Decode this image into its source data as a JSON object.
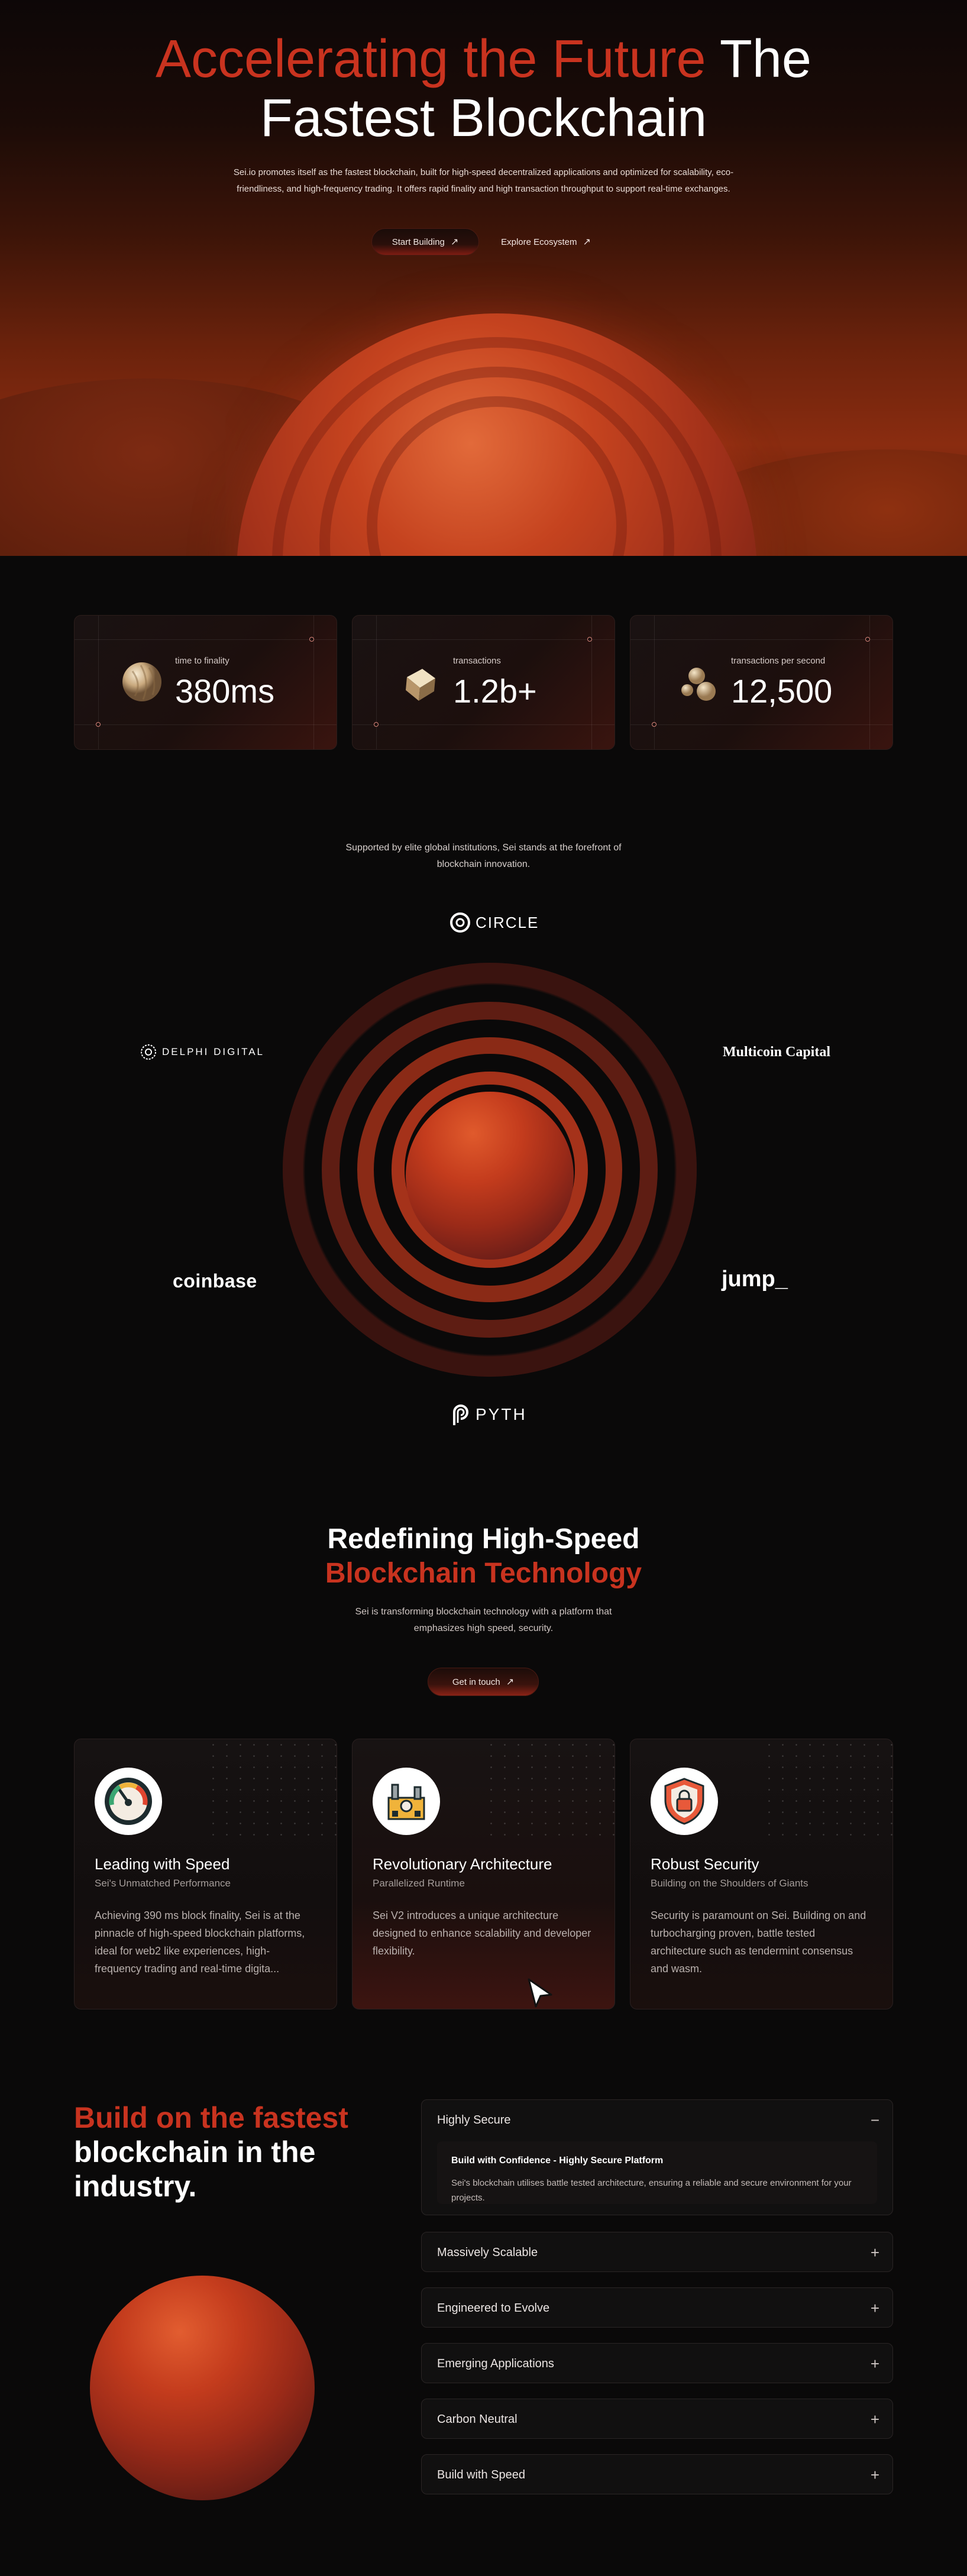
{
  "hero": {
    "title_accent": "Accelerating the Future",
    "title_rest_1": "The",
    "title_rest_2": "Fastest Blockchain",
    "description": "Sei.io promotes itself as the fastest blockchain, built for high-speed decentralized applications and optimized for scalability, eco-friendliness, and high-frequency trading. It offers rapid finality and high transaction throughput to support real-time exchanges.",
    "primary_button": "Start Building",
    "secondary_button": "Explore Ecosystem",
    "arrow": "↗"
  },
  "stats": [
    {
      "label": "time to finality",
      "value": "380ms",
      "icon": "sphere-icon"
    },
    {
      "label": "transactions",
      "value": "1.2b+",
      "icon": "cube-icon"
    },
    {
      "label": "transactions per second",
      "value": "12,500",
      "icon": "spheres-icon"
    }
  ],
  "support": {
    "text": "Supported by elite global institutions, Sei stands at the forefront of blockchain innovation.",
    "logos": {
      "circle": "CIRCLE",
      "delphi": "DELPHI DIGITAL",
      "multicoin": "Multicoin Capital",
      "coinbase": "coinbase",
      "jump": "jump_",
      "pyth": "PYTH"
    }
  },
  "redefining": {
    "title_line1": "Redefining High-Speed",
    "title_line2": "Blockchain Technology",
    "description": "Sei is transforming blockchain technology with a platform that emphasizes high speed, security.",
    "button": "Get in touch",
    "arrow": "↗"
  },
  "features": [
    {
      "title": "Leading with Speed",
      "subtitle": "Sei's Unmatched Performance",
      "body": "Achieving 390 ms block finality, Sei is at the pinnacle of high-speed blockchain platforms, ideal for web2 like experiences, high-frequency trading and real-time digita...",
      "icon": "speedometer-icon"
    },
    {
      "title": "Revolutionary Architecture",
      "subtitle": "Parallelized Runtime",
      "body": "Sei V2 introduces a unique architecture designed to enhance scalability and developer flexibility.",
      "icon": "factory-icon"
    },
    {
      "title": "Robust Security",
      "subtitle": "Building on the Shoulders of Giants",
      "body": "Security is paramount on Sei. Building on and turbocharging proven, battle tested architecture such as tendermint consensus and wasm.",
      "icon": "shield-lock-icon"
    }
  ],
  "build": {
    "title_accent": "Build on the fastest",
    "title_rest": "blockchain in the industry.",
    "accordion": [
      {
        "title": "Highly Secure",
        "toggle": "−",
        "open": true,
        "subtitle": "Build with Confidence - Highly Secure Platform",
        "text": "Sei's blockchain utilises battle tested architecture, ensuring a reliable and secure environment for your projects."
      },
      {
        "title": "Massively Scalable",
        "toggle": "+",
        "open": false
      },
      {
        "title": "Engineered to Evolve",
        "toggle": "+",
        "open": false
      },
      {
        "title": "Emerging Applications",
        "toggle": "+",
        "open": false
      },
      {
        "title": "Carbon Neutral",
        "toggle": "+",
        "open": false
      },
      {
        "title": "Build with Speed",
        "toggle": "+",
        "open": false
      }
    ]
  },
  "colors": {
    "accent": "#c9331f",
    "background": "#0a0909"
  }
}
